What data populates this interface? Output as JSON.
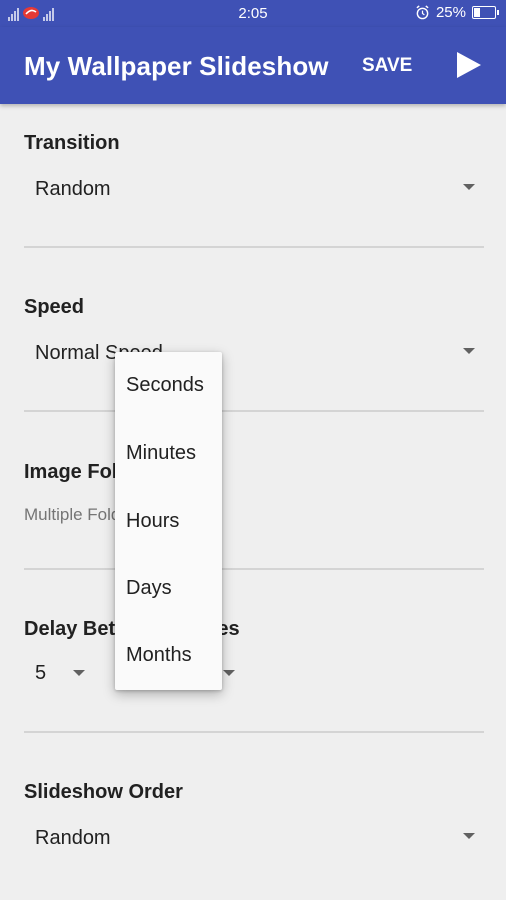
{
  "status_bar": {
    "time": "2:05",
    "battery_percent": "25%",
    "battery_level": 0.25,
    "icons": [
      "signal-icon",
      "notification-icon",
      "alarm-icon",
      "battery-icon"
    ]
  },
  "app_bar": {
    "title": "My Wallpaper Slideshow",
    "save_label": "SAVE",
    "play_icon": "play-icon",
    "color": "#3f51b5"
  },
  "settings": {
    "transition": {
      "label": "Transition",
      "value": "Random"
    },
    "speed": {
      "label": "Speed",
      "value": "Normal Speed"
    },
    "image_folders": {
      "label": "Image Folders",
      "value": "Multiple Folders"
    },
    "delay": {
      "label": "Delay Between Images",
      "amount": "5"
    },
    "order": {
      "label": "Slideshow Order",
      "value": "Random"
    }
  },
  "dropdown": {
    "options": [
      "Seconds",
      "Minutes",
      "Hours",
      "Days",
      "Months"
    ]
  }
}
